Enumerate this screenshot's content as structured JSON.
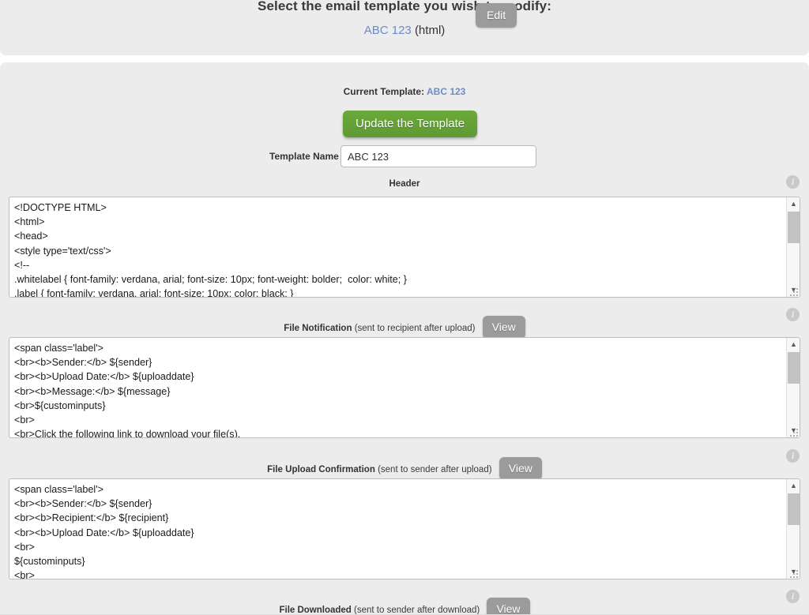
{
  "top_panel": {
    "title": "Select the email template you wish to modify:",
    "template_name": "ABC 123",
    "template_kind": "(html)",
    "edit_label": "Edit"
  },
  "main_panel": {
    "current_template_label": "Current Template:",
    "current_template_name": "ABC 123",
    "update_button_label": "Update the Template",
    "template_name_label": "Template Name",
    "template_name_value": "ABC 123",
    "template_name_placeholder": "Template Name",
    "info_icon": "info-icon"
  },
  "sections": [
    {
      "id": "header",
      "title": "Header",
      "note": "",
      "has_view_button": false,
      "view_label": "View",
      "content": "<!DOCTYPE HTML>\n<html>\n<head>\n<style type='text/css'>\n<!--\n.whitelabel { font-family: verdana, arial; font-size: 10px; font-weight: bolder;  color: white; }\n.label { font-family: verdana, arial; font-size: 10px; color: black; }"
    },
    {
      "id": "file-notification",
      "title": "File Notification",
      "note": "(sent to recipient after upload)",
      "has_view_button": true,
      "view_label": "View",
      "content": "<span class='label'>\n<br><b>Sender:</b> ${sender}\n<br><b>Upload Date:</b> ${uploaddate}\n<br><b>Message:</b> ${message}\n<br>${custominputs}\n<br>\n<br>Click the following link to download your file(s)."
    },
    {
      "id": "file-upload-confirmation",
      "title": "File Upload Confirmation",
      "note": "(sent to sender after upload)",
      "has_view_button": true,
      "view_label": "View",
      "content": "<span class='label'>\n<br><b>Sender:</b> ${sender}\n<br><b>Recipient:</b> ${recipient}\n<br><b>Upload Date:</b> ${uploaddate}\n<br>\n${custominputs}\n<br>"
    },
    {
      "id": "file-downloaded",
      "title": "File Downloaded",
      "note": "(sent to sender after download)",
      "has_view_button": true,
      "view_label": "View",
      "content": ""
    }
  ],
  "colors": {
    "panel_bg": "#ececec",
    "accent_green": "#65a137",
    "grey_button": "#9b9b9b",
    "link_blue": "#6b8cc7"
  }
}
